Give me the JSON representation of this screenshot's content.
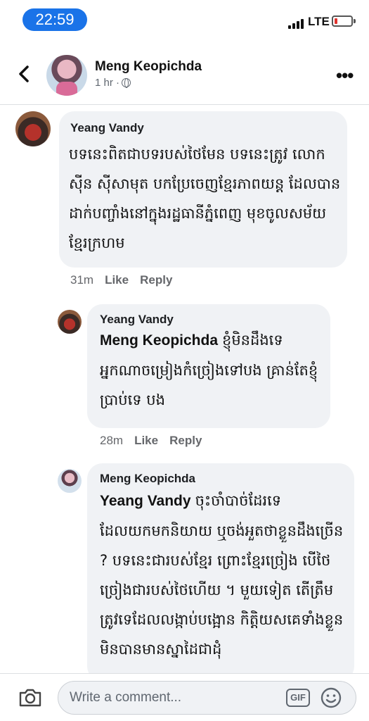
{
  "status_bar": {
    "time": "22:59",
    "network": "LTE"
  },
  "header": {
    "name": "Meng Keopichda",
    "time": "1 hr ·"
  },
  "comments": [
    {
      "author": "Yeang Vandy",
      "text": "បទនេះពិតជាបទរបស់ថៃមែន បទនេះត្រូវ លោកស៊ីន ស៊ីសាមុត បកប្រែចេញខ្មែរភាពយន្ត ដែលបានដាក់បញ្ចាំងនៅក្នុងរដ្ឋធានីភ្នំពេញ មុខចូលសម័យខ្មែរក្រហម",
      "time": "31m",
      "like": "Like",
      "reply": "Reply"
    },
    {
      "author": "Yeang Vandy",
      "mention": "Meng Keopichda",
      "text": "ខ្ញុំមិនដឹងទេ អ្នកណាចម្រៀងកំច្រៀងទៅបង គ្រាន់តែខ្ញុំប្រាប់ទេ បង",
      "time": "28m",
      "like": "Like",
      "reply": "Reply"
    },
    {
      "author": "Meng Keopichda",
      "mention": "Yeang Vandy",
      "text": "ចុះចាំបាច់ដែរទេដែលយកមកនិយាយ ឬចង់អួតថាខ្លួនដឹងច្រើន ? បទនេះជារបស់ខ្មែរ ព្រោះខ្មែរច្រៀង បើថៃច្រៀងជារបស់ថៃហើយ ។ មួយទៀត តើត្រឹមត្រូវទេដែលលង្កាប់បង្អោន កិត្តិយសគេទាំងខ្លួនមិនបានមានស្នាដៃជាដុំ"
    }
  ],
  "composer": {
    "placeholder": "Write a comment...",
    "gif": "GIF"
  },
  "icons": {
    "back": "chevron-left-icon",
    "more": "more-icon",
    "globe": "globe-icon",
    "camera": "camera-icon",
    "gif": "gif-icon",
    "emoji": "emoji-icon"
  },
  "colors": {
    "time_pill": "#1a73e8",
    "bubble": "#f0f2f5",
    "battery_low": "#e0342f"
  }
}
